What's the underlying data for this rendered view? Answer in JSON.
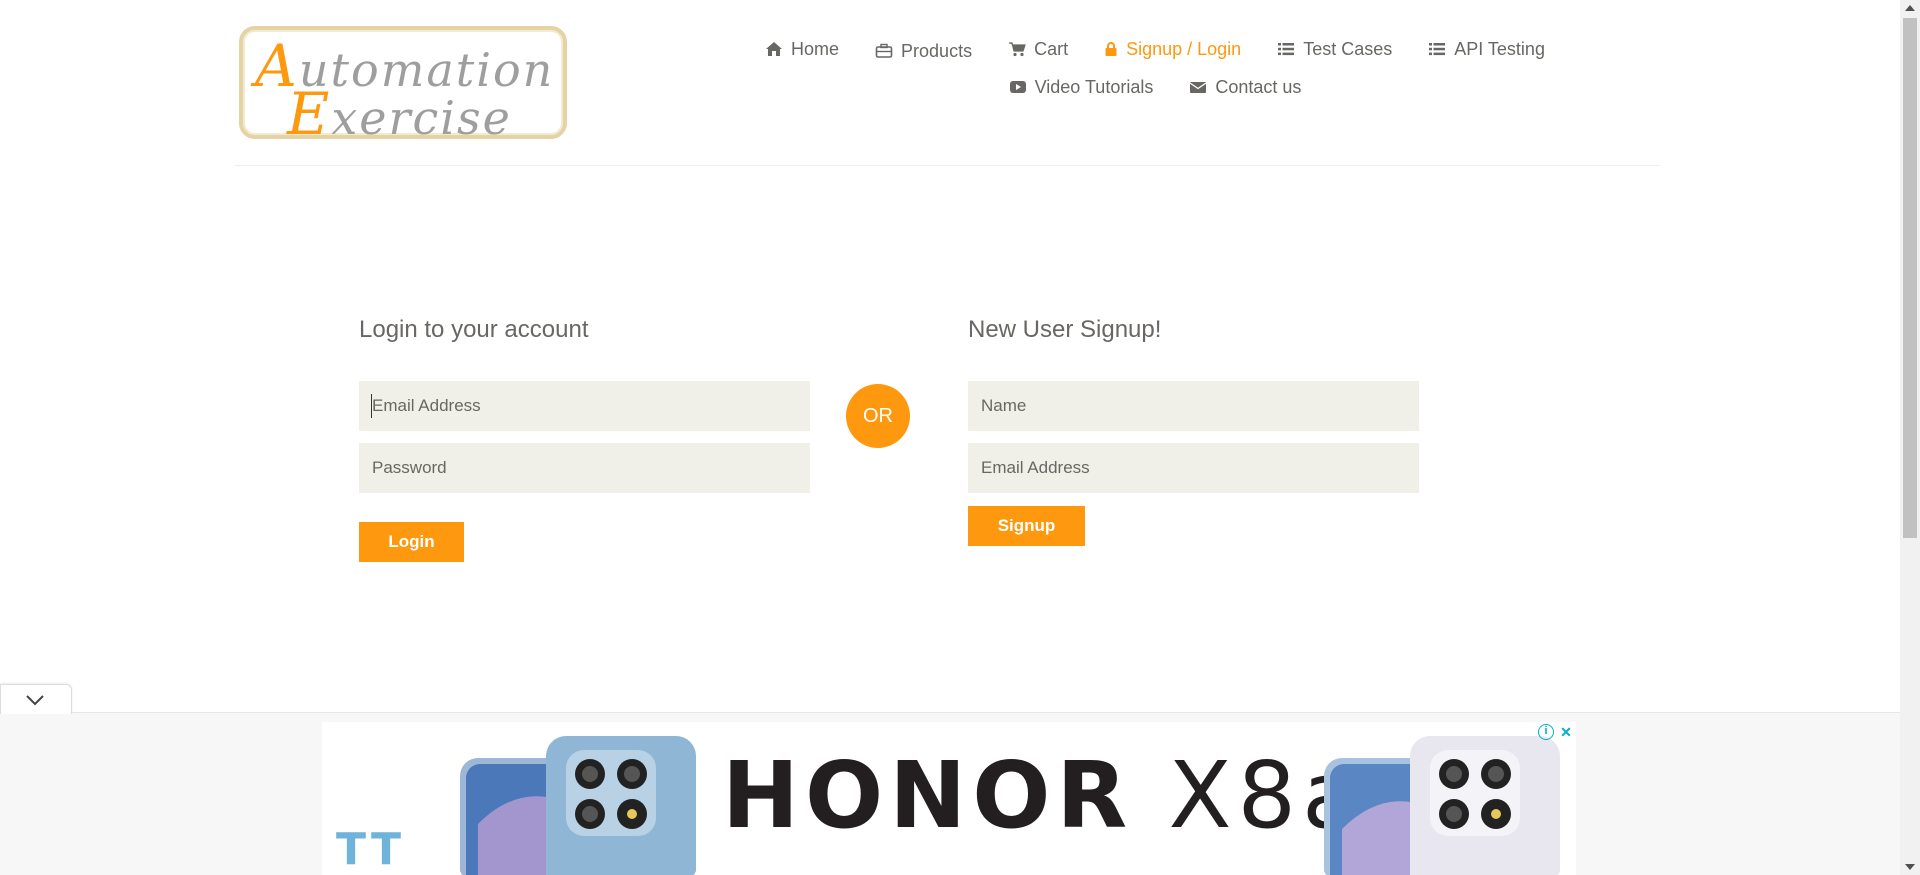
{
  "header": {
    "logo": {
      "line1_cap": "A",
      "line1_rest": "utomation",
      "line2_cap": "E",
      "line2_rest": "xercise"
    },
    "nav": [
      {
        "label": "Home",
        "icon": "home-icon"
      },
      {
        "label": "Products",
        "icon": "briefcase-icon"
      },
      {
        "label": "Cart",
        "icon": "cart-icon"
      },
      {
        "label": "Signup / Login",
        "icon": "lock-icon",
        "active": true
      },
      {
        "label": "Test Cases",
        "icon": "list-icon"
      },
      {
        "label": "API Testing",
        "icon": "list-icon"
      },
      {
        "label": "Video Tutorials",
        "icon": "youtube-play-icon"
      },
      {
        "label": "Contact us",
        "icon": "envelope-icon"
      }
    ]
  },
  "login": {
    "title": "Login to your account",
    "email_placeholder": "Email Address",
    "password_placeholder": "Password",
    "button": "Login"
  },
  "or_label": "OR",
  "signup": {
    "title": "New User Signup!",
    "name_placeholder": "Name",
    "email_placeholder": "Email Address",
    "button": "Signup"
  },
  "ad": {
    "headline_bold": "HONOR",
    "headline_model": "X8a",
    "brand_mark": "TT"
  },
  "colors": {
    "accent": "#fe980f",
    "text": "#696763",
    "input_bg": "#f0f0e9"
  }
}
